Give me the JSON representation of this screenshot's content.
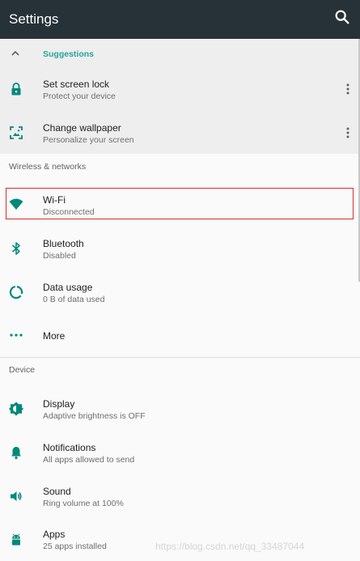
{
  "app_bar": {
    "title": "Settings",
    "search_icon": "search-icon"
  },
  "suggestions": {
    "label": "Suggestions",
    "items": [
      {
        "title": "Set screen lock",
        "subtitle": "Protect your device",
        "icon": "lock-icon"
      },
      {
        "title": "Change wallpaper",
        "subtitle": "Personalize your screen",
        "icon": "wallpaper-icon"
      }
    ]
  },
  "sections": {
    "wireless": {
      "header": "Wireless & networks",
      "items": [
        {
          "title": "Wi-Fi",
          "subtitle": "Disconnected",
          "icon": "wifi-icon"
        },
        {
          "title": "Bluetooth",
          "subtitle": "Disabled",
          "icon": "bluetooth-icon"
        },
        {
          "title": "Data usage",
          "subtitle": "0 B of data used",
          "icon": "data-usage-icon"
        },
        {
          "title": "More",
          "icon": "more-horiz-icon"
        }
      ]
    },
    "device": {
      "header": "Device",
      "items": [
        {
          "title": "Display",
          "subtitle": "Adaptive brightness is OFF",
          "icon": "brightness-icon"
        },
        {
          "title": "Notifications",
          "subtitle": "All apps allowed to send",
          "icon": "bell-icon"
        },
        {
          "title": "Sound",
          "subtitle": "Ring volume at 100%",
          "icon": "volume-icon"
        },
        {
          "title": "Apps",
          "subtitle": "25 apps installed",
          "icon": "android-icon"
        }
      ]
    }
  },
  "watermark": "https://blog.csdn.net/qq_33487044",
  "colors": {
    "app_bar": "#263238",
    "accent": "#009688",
    "highlight_border": "#d32f2f"
  }
}
